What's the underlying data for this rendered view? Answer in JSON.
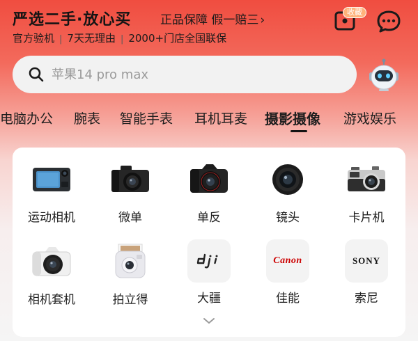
{
  "header": {
    "title": "严选二手·放心买",
    "guarantee": "正品保障 假一赔三",
    "guarantee_chevron": "›",
    "perks": [
      "官方验机",
      "7天无理由",
      "2000+门店全国联保"
    ],
    "favorite_badge": "收藏"
  },
  "search": {
    "placeholder": "苹果14 pro max"
  },
  "tabs": [
    {
      "label": "电脑办公",
      "active": false
    },
    {
      "label": "腕表",
      "active": false
    },
    {
      "label": "智能手表",
      "active": false
    },
    {
      "label": "耳机耳麦",
      "active": false
    },
    {
      "label": "摄影摄像",
      "active": true
    },
    {
      "label": "游戏娱乐",
      "active": false
    }
  ],
  "categories": [
    {
      "label": "运动相机",
      "icon": "action-camera-icon"
    },
    {
      "label": "微单",
      "icon": "mirrorless-camera-icon"
    },
    {
      "label": "单反",
      "icon": "dslr-camera-icon"
    },
    {
      "label": "镜头",
      "icon": "lens-icon"
    },
    {
      "label": "卡片机",
      "icon": "compact-camera-icon"
    },
    {
      "label": "相机套机",
      "icon": "camera-kit-icon"
    },
    {
      "label": "拍立得",
      "icon": "instant-camera-icon"
    },
    {
      "label": "大疆",
      "icon": "dji-logo",
      "brand_text": "dji"
    },
    {
      "label": "佳能",
      "icon": "canon-logo",
      "brand_text": "Canon"
    },
    {
      "label": "索尼",
      "icon": "sony-logo",
      "brand_text": "SONY"
    }
  ],
  "colors": {
    "header_red": "#f04d40",
    "canon_red": "#cc0000",
    "badge_orange": "#ffb27a"
  }
}
